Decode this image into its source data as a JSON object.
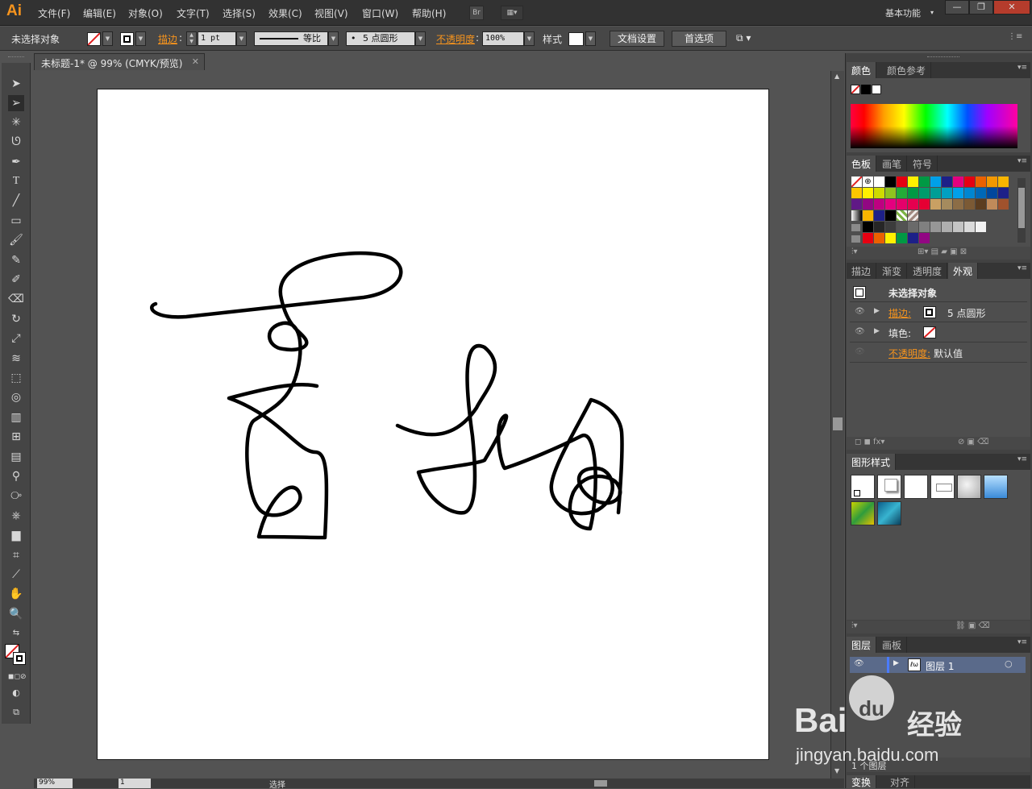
{
  "app": {
    "logo": "Ai"
  },
  "menu": [
    "文件(F)",
    "编辑(E)",
    "对象(O)",
    "文字(T)",
    "选择(S)",
    "效果(C)",
    "视图(V)",
    "窗口(W)",
    "帮助(H)"
  ],
  "menubar": {
    "bridge_label": "Br",
    "workspace": "基本功能"
  },
  "control": {
    "selection": "未选择对象",
    "stroke_label": "描边",
    "stroke_weight": "1 pt",
    "stroke_profile": "等比",
    "brush": "5 点圆形",
    "opacity_label": "不透明度",
    "opacity_value": "100%",
    "style_label": "样式",
    "doc_setup": "文档设置",
    "preferences": "首选项"
  },
  "document": {
    "tab_title": "未标题-1* @ 99% (CMYK/预览)"
  },
  "status": {
    "zoom": "99%",
    "artboard": "1",
    "tool": "选择"
  },
  "panels": {
    "color": {
      "tabs": [
        "颜色",
        "颜色参考"
      ]
    },
    "swatches": {
      "tabs": [
        "色板",
        "画笔",
        "符号"
      ]
    },
    "appearance": {
      "tabs": [
        "描边",
        "渐变",
        "透明度",
        "外观"
      ],
      "title": "未选择对象",
      "stroke_label": "描边:",
      "stroke_value": "5 点圆形",
      "fill_label": "填色:",
      "opacity_label": "不透明度:",
      "opacity_value": "默认值"
    },
    "graphic_styles": {
      "tabs": [
        "图形样式"
      ]
    },
    "layers": {
      "tabs": [
        "图层",
        "画板"
      ],
      "layer_name": "图层 1",
      "count": "1 个图层"
    },
    "bottom": {
      "tabs": [
        "变换",
        "对齐"
      ]
    }
  },
  "watermark": {
    "brand": "Bai",
    "brand2": "du",
    "cn": "经验",
    "url": "jingyan.baidu.com"
  },
  "colors": {
    "accent_orange": "#f7941d",
    "panel_bg": "#4e4e4e",
    "chrome": "#323232"
  }
}
